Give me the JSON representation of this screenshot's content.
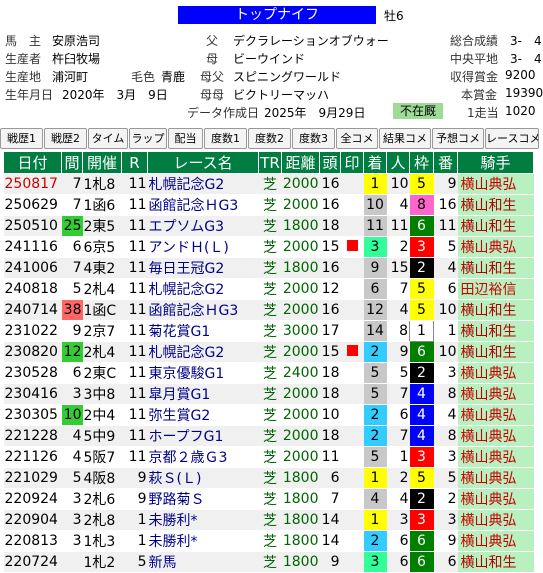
{
  "horse": {
    "name": "トップナイフ",
    "sex_age": "牡6",
    "owner_label": "馬　主",
    "owner": "安原浩司",
    "breeder_label": "生産者",
    "breeder": "杵臼牧場",
    "birthplace_label": "生産地",
    "birthplace": "浦河町",
    "coat_label": "毛色",
    "coat": "青鹿",
    "birthdate_label": "生年月日",
    "birthdate": "2020年　3月　9日",
    "sire_label": "父",
    "sire": "デクラレーションオブウォー",
    "dam_label": "母",
    "dam": "ビーウインド",
    "damsire_label": "母父",
    "damsire": "スピニングワールド",
    "damdam_label": "母母",
    "damdam": "ビクトリーマッハ",
    "data_date_label": "データ作成日",
    "data_date": "2025年　9月29日",
    "status": "不在厩",
    "total_label": "総合成績",
    "total": "3-　4",
    "central_label": "中央平地",
    "central": "3-　4",
    "prize_label": "収得賞金",
    "prize": "9200",
    "main_prize_label": "本賞金",
    "main_prize": "19390",
    "per_start_label": "1走当",
    "per_start": "1020"
  },
  "tabs": [
    "戦歴1",
    "戦歴2",
    "タイム",
    "ラップ",
    "配当",
    "度数1",
    "度数2",
    "度数3",
    "全コメ",
    "結果コメ",
    "予想コメ",
    "レースコメ"
  ],
  "columns": [
    "日付",
    "間",
    "開催",
    "R",
    "レース名",
    "TR",
    "距離",
    "頭",
    "印",
    "着",
    "人",
    "枠",
    "番",
    "騎手"
  ],
  "races": [
    {
      "date": "250817",
      "interval": "7",
      "venue": "1札8",
      "r": "11",
      "race": "札幌記念G2",
      "surface": "芝",
      "dist": "2000",
      "heads": "16",
      "mark": "",
      "fin": "1",
      "pop": "10",
      "waku": "5",
      "ban": "9",
      "jockey": "横山典弘",
      "recent": true
    },
    {
      "date": "250629",
      "interval": "7",
      "venue": "1函6",
      "r": "11",
      "race": "函館記念ＨG3",
      "surface": "芝",
      "dist": "2000",
      "heads": "16",
      "mark": "",
      "fin": "10",
      "pop": "4",
      "waku": "8",
      "ban": "16",
      "jockey": "横山和生"
    },
    {
      "date": "250510",
      "interval": "25",
      "venue": "2東5",
      "r": "11",
      "race": "エプソムG3",
      "surface": "芝",
      "dist": "1800",
      "heads": "18",
      "mark": "",
      "fin": "11",
      "pop": "11",
      "waku": "6",
      "ban": "11",
      "jockey": "横山和生"
    },
    {
      "date": "241116",
      "interval": "6",
      "venue": "6京5",
      "r": "11",
      "race": "アンドＨ(Ｌ)",
      "surface": "芝",
      "dist": "2000",
      "heads": "15",
      "mark": "■",
      "fin": "3",
      "pop": "2",
      "waku": "3",
      "ban": "5",
      "jockey": "横山典弘"
    },
    {
      "date": "241006",
      "interval": "7",
      "venue": "4東2",
      "r": "11",
      "race": "毎日王冠G2",
      "surface": "芝",
      "dist": "1800",
      "heads": "16",
      "mark": "",
      "fin": "9",
      "pop": "15",
      "waku": "2",
      "ban": "4",
      "jockey": "横山和生"
    },
    {
      "date": "240818",
      "interval": "5",
      "venue": "2札4",
      "r": "11",
      "race": "札幌記念G2",
      "surface": "芝",
      "dist": "2000",
      "heads": "12",
      "mark": "",
      "fin": "6",
      "pop": "7",
      "waku": "5",
      "ban": "6",
      "jockey": "田辺裕信"
    },
    {
      "date": "240714",
      "interval": "38",
      "venue": "1函C",
      "r": "11",
      "race": "函館記念ＨG3",
      "surface": "芝",
      "dist": "2000",
      "heads": "16",
      "mark": "",
      "fin": "12",
      "pop": "4",
      "waku": "5",
      "ban": "10",
      "jockey": "横山和生"
    },
    {
      "date": "231022",
      "interval": "9",
      "venue": "2京7",
      "r": "11",
      "race": "菊花賞G1",
      "surface": "芝",
      "dist": "3000",
      "heads": "17",
      "mark": "",
      "fin": "14",
      "pop": "8",
      "waku": "1",
      "ban": "1",
      "jockey": "横山和生"
    },
    {
      "date": "230820",
      "interval": "12",
      "venue": "2札4",
      "r": "11",
      "race": "札幌記念G2",
      "surface": "芝",
      "dist": "2000",
      "heads": "15",
      "mark": "■",
      "fin": "2",
      "pop": "9",
      "waku": "6",
      "ban": "10",
      "jockey": "横山和生"
    },
    {
      "date": "230528",
      "interval": "6",
      "venue": "2東C",
      "r": "11",
      "race": "東京優駿G1",
      "surface": "芝",
      "dist": "2400",
      "heads": "18",
      "mark": "",
      "fin": "5",
      "pop": "5",
      "waku": "2",
      "ban": "3",
      "jockey": "横山典弘"
    },
    {
      "date": "230416",
      "interval": "3",
      "venue": "3中8",
      "r": "11",
      "race": "皐月賞G1",
      "surface": "芝",
      "dist": "2000",
      "heads": "18",
      "mark": "",
      "fin": "5",
      "pop": "7",
      "waku": "4",
      "ban": "8",
      "jockey": "横山典弘"
    },
    {
      "date": "230305",
      "interval": "10",
      "venue": "2中4",
      "r": "11",
      "race": "弥生賞G2",
      "surface": "芝",
      "dist": "2000",
      "heads": "10",
      "mark": "",
      "fin": "2",
      "pop": "6",
      "waku": "4",
      "ban": "4",
      "jockey": "横山典弘"
    },
    {
      "date": "221228",
      "interval": "4",
      "venue": "5中9",
      "r": "11",
      "race": "ホープフG1",
      "surface": "芝",
      "dist": "2000",
      "heads": "18",
      "mark": "",
      "fin": "2",
      "pop": "7",
      "waku": "4",
      "ban": "8",
      "jockey": "横山典弘"
    },
    {
      "date": "221126",
      "interval": "4",
      "venue": "5阪7",
      "r": "11",
      "race": "京都２歳Ｇ3",
      "surface": "芝",
      "dist": "2000",
      "heads": "11",
      "mark": "",
      "fin": "5",
      "pop": "1",
      "waku": "3",
      "ban": "3",
      "jockey": "横山典弘"
    },
    {
      "date": "221029",
      "interval": "5",
      "venue": "4阪8",
      "r": "9",
      "race": "萩Ｓ(Ｌ)",
      "surface": "芝",
      "dist": "1800",
      "heads": "6",
      "mark": "",
      "fin": "1",
      "pop": "2",
      "waku": "5",
      "ban": "5",
      "jockey": "横山典弘"
    },
    {
      "date": "220924",
      "interval": "3",
      "venue": "2札6",
      "r": "9",
      "race": "野路菊Ｓ",
      "surface": "芝",
      "dist": "1800",
      "heads": "7",
      "mark": "",
      "fin": "4",
      "pop": "4",
      "waku": "2",
      "ban": "2",
      "jockey": "横山典弘"
    },
    {
      "date": "220904",
      "interval": "3",
      "venue": "2札8",
      "r": "1",
      "race": "未勝利*",
      "surface": "芝",
      "dist": "1800",
      "heads": "14",
      "mark": "",
      "fin": "1",
      "pop": "3",
      "waku": "3",
      "ban": "3",
      "jockey": "横山典弘"
    },
    {
      "date": "220813",
      "interval": "3",
      "venue": "1札3",
      "r": "1",
      "race": "未勝利*",
      "surface": "芝",
      "dist": "1800",
      "heads": "14",
      "mark": "",
      "fin": "2",
      "pop": "6",
      "waku": "6",
      "ban": "9",
      "jockey": "横山典弘"
    },
    {
      "date": "220724",
      "interval": "",
      "venue": "1札2",
      "r": "5",
      "race": "新馬",
      "surface": "芝",
      "dist": "1800",
      "heads": "9",
      "mark": "",
      "fin": "3",
      "pop": "6",
      "waku": "6",
      "ban": "6",
      "jockey": "横山和生"
    }
  ]
}
